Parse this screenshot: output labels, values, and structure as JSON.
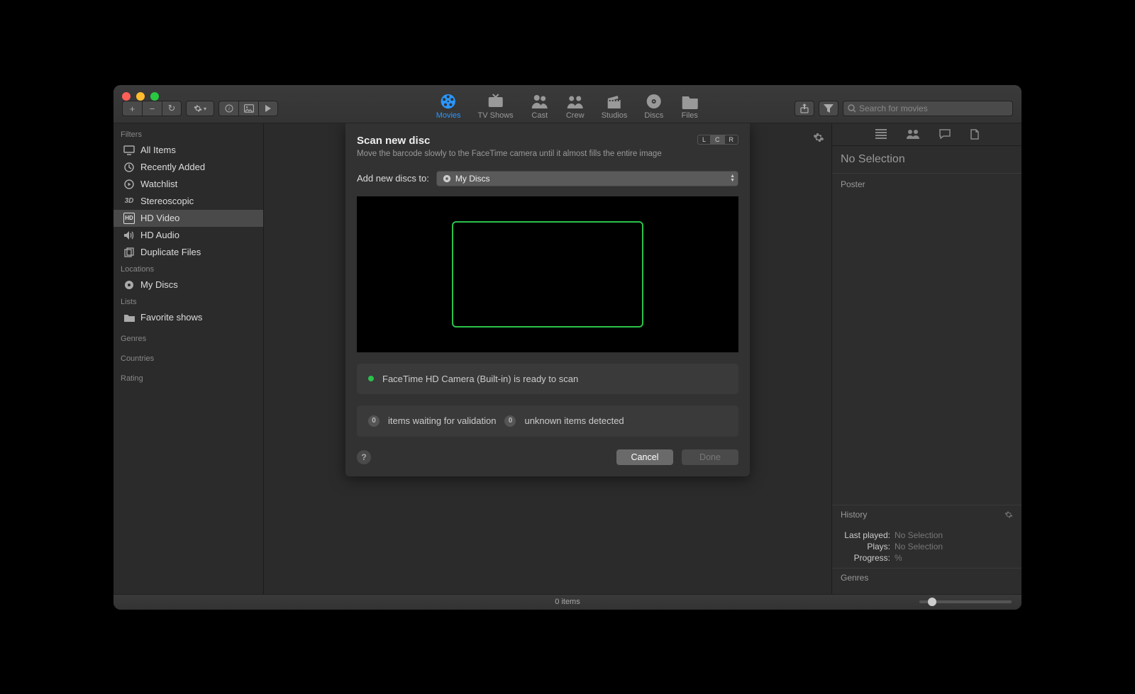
{
  "tabs": {
    "movies": "Movies",
    "tvshows": "TV Shows",
    "cast": "Cast",
    "crew": "Crew",
    "studios": "Studios",
    "discs": "Discs",
    "files": "Files"
  },
  "search": {
    "placeholder": "Search for movies"
  },
  "sidebar": {
    "filters_h": "Filters",
    "locations_h": "Locations",
    "lists_h": "Lists",
    "genres_h": "Genres",
    "countries_h": "Countries",
    "rating_h": "Rating",
    "items": {
      "all": "All Items",
      "recent": "Recently Added",
      "watchlist": "Watchlist",
      "stereo": "Stereoscopic",
      "hdvideo": "HD Video",
      "hdaudio": "HD Audio",
      "dup": "Duplicate Files",
      "mydiscs": "My Discs",
      "favshows": "Favorite shows"
    }
  },
  "dialog": {
    "title": "Scan new disc",
    "subtitle": "Move the barcode slowly to the FaceTime camera until it almost fills the entire image",
    "lcr": {
      "l": "L",
      "c": "C",
      "r": "R"
    },
    "add_label": "Add new discs to:",
    "select_value": "My Discs",
    "camera_status": "FaceTime HD Camera (Built-in) is ready to scan",
    "waiting_count": "0",
    "waiting_label": "items waiting for validation",
    "unknown_count": "0",
    "unknown_label": "unknown items detected",
    "cancel": "Cancel",
    "done": "Done"
  },
  "inspector": {
    "title": "No Selection",
    "poster_h": "Poster",
    "history_h": "History",
    "lastplayed_k": "Last played:",
    "lastplayed_v": "No Selection",
    "plays_k": "Plays:",
    "plays_v": "No Selection",
    "progress_k": "Progress:",
    "progress_v": "%",
    "genres_h": "Genres"
  },
  "status": {
    "items": "0 items"
  }
}
